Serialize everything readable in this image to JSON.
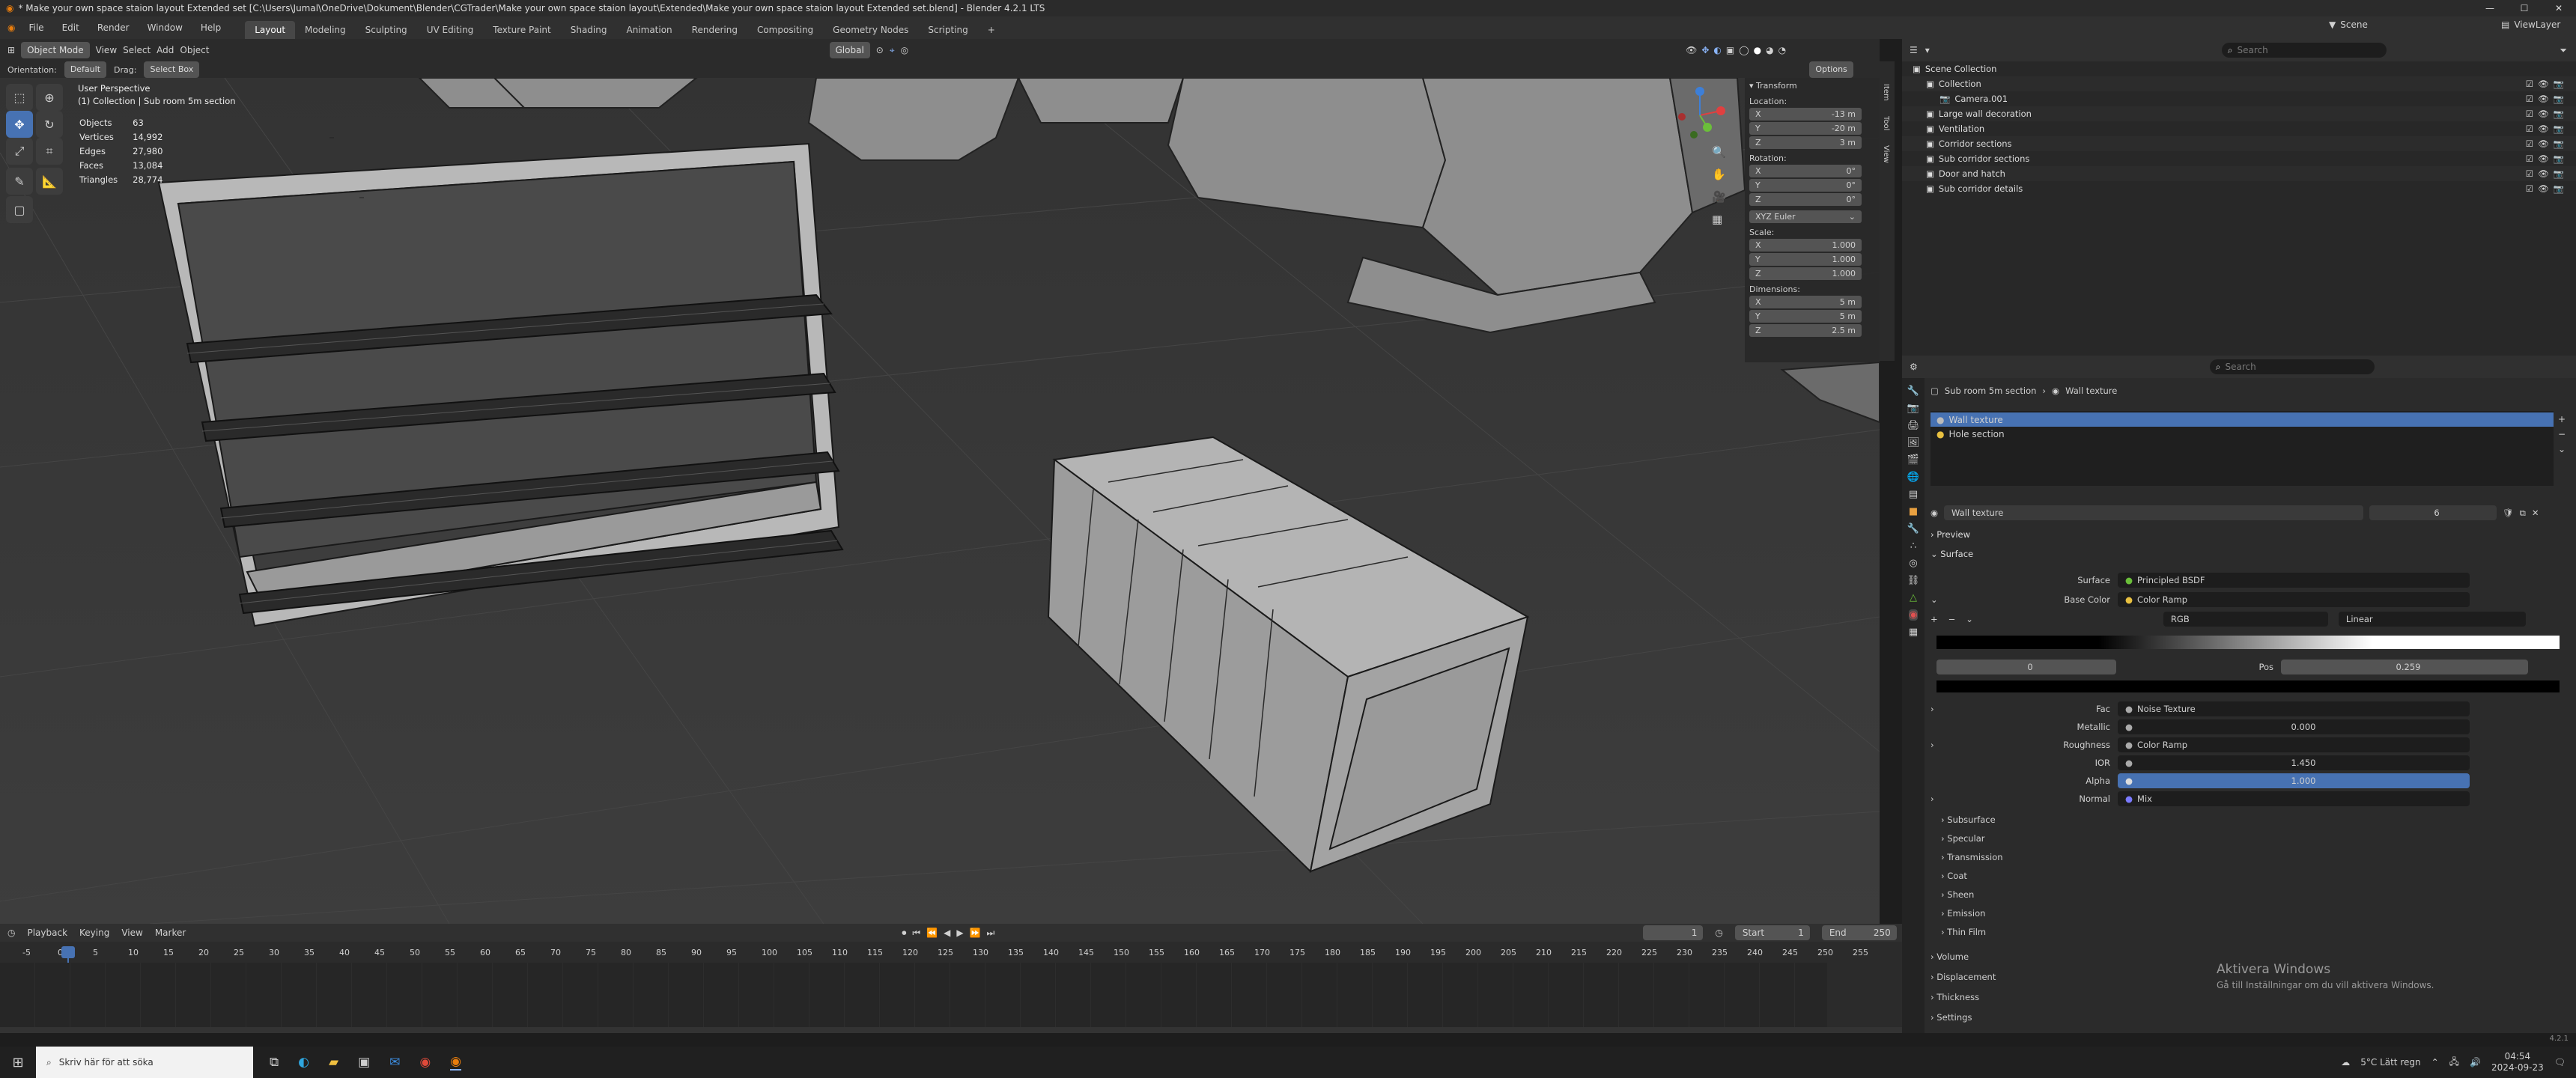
{
  "titlebar": {
    "title": "* Make your own space staion layout Extended set [C:\\Users\\Jumal\\OneDrive\\Dokument\\Blender\\CGTrader\\Make your own space staion layout\\Extended\\Make your own space staion layout Extended set.blend] - Blender 4.2.1 LTS"
  },
  "menu": [
    "File",
    "Edit",
    "Render",
    "Window",
    "Help"
  ],
  "workspaces": [
    "Layout",
    "Modeling",
    "Sculpting",
    "UV Editing",
    "Texture Paint",
    "Shading",
    "Animation",
    "Rendering",
    "Compositing",
    "Geometry Nodes",
    "Scripting"
  ],
  "scene": {
    "label": "Scene",
    "viewlayer": "ViewLayer"
  },
  "header": {
    "mode": "Object Mode",
    "view": "View",
    "select": "Select",
    "add": "Add",
    "object": "Object",
    "orientation": "Global"
  },
  "subheader": {
    "orientation_label": "Orientation:",
    "orientation_value": "Default",
    "drag_label": "Drag:",
    "drag_value": "Select Box",
    "options": "Options"
  },
  "viewport": {
    "persp": "User Perspective",
    "context": "(1) Collection | Sub room 5m section",
    "stats": [
      {
        "k": "Objects",
        "v": "63"
      },
      {
        "k": "Vertices",
        "v": "14,992"
      },
      {
        "k": "Edges",
        "v": "27,980"
      },
      {
        "k": "Faces",
        "v": "13,084"
      },
      {
        "k": "Triangles",
        "v": "28,774"
      }
    ]
  },
  "transform": {
    "title": "Transform",
    "location_label": "Location:",
    "location": [
      {
        "a": "X",
        "v": "-13 m"
      },
      {
        "a": "Y",
        "v": "-20 m"
      },
      {
        "a": "Z",
        "v": "3 m"
      }
    ],
    "rotation_label": "Rotation:",
    "rotation": [
      {
        "a": "X",
        "v": "0°"
      },
      {
        "a": "Y",
        "v": "0°"
      },
      {
        "a": "Z",
        "v": "0°"
      }
    ],
    "euler": "XYZ Euler",
    "scale_label": "Scale:",
    "scale": [
      {
        "a": "X",
        "v": "1.000"
      },
      {
        "a": "Y",
        "v": "1.000"
      },
      {
        "a": "Z",
        "v": "1.000"
      }
    ],
    "dims_label": "Dimensions:",
    "dims": [
      {
        "a": "X",
        "v": "5 m"
      },
      {
        "a": "Y",
        "v": "5 m"
      },
      {
        "a": "Z",
        "v": "2.5 m"
      }
    ]
  },
  "ntabs": [
    "Item",
    "Tool",
    "View"
  ],
  "outliner": {
    "search": "Search",
    "items": [
      {
        "name": "Scene Collection",
        "indent": 0
      },
      {
        "name": "Collection",
        "indent": 1
      },
      {
        "name": "Camera.001",
        "indent": 2
      },
      {
        "name": "Large wall decoration",
        "indent": 1
      },
      {
        "name": "Ventilation",
        "indent": 1
      },
      {
        "name": "Corridor sections",
        "indent": 1
      },
      {
        "name": "Sub corridor sections",
        "indent": 1
      },
      {
        "name": "Door and hatch",
        "indent": 1
      },
      {
        "name": "Sub corridor details",
        "indent": 1
      }
    ]
  },
  "properties": {
    "search": "Search",
    "breadcrumb_obj": "Sub room 5m section",
    "breadcrumb_mat": "Wall texture",
    "slots": [
      "Wall texture",
      "Hole section"
    ],
    "material_name": "Wall texture",
    "users": "6",
    "preview": "Preview",
    "surface_section": "Surface",
    "surface_label": "Surface",
    "surface_value": "Principled BSDF",
    "basecolor_label": "Base Color",
    "basecolor_value": "Color Ramp",
    "ramp_mode": "RGB",
    "ramp_interp": "Linear",
    "ramp_index": "0",
    "pos_label": "Pos",
    "pos_value": "0.259",
    "fac_label": "Fac",
    "fac_value": "Noise Texture",
    "metallic_label": "Metallic",
    "metallic_value": "0.000",
    "roughness_label": "Roughness",
    "roughness_value": "Color Ramp",
    "ior_label": "IOR",
    "ior_value": "1.450",
    "alpha_label": "Alpha",
    "alpha_value": "1.000",
    "normal_label": "Normal",
    "normal_value": "Mix",
    "subsections": [
      "Subsurface",
      "Specular",
      "Transmission",
      "Coat",
      "Sheen",
      "Emission",
      "Thin Film"
    ],
    "sections": [
      "Volume",
      "Displacement",
      "Thickness",
      "Settings"
    ]
  },
  "timeline": {
    "playback": "Playback",
    "keying": "Keying",
    "view": "View",
    "marker": "Marker",
    "current": "1",
    "start_label": "Start",
    "start": "1",
    "end_label": "End",
    "end": "250",
    "ticks": [
      "-5",
      "0",
      "5",
      "10",
      "15",
      "20",
      "25",
      "30",
      "35",
      "40",
      "45",
      "50",
      "55",
      "60",
      "65",
      "70",
      "75",
      "80",
      "85",
      "90",
      "95",
      "100",
      "105",
      "110",
      "115",
      "120",
      "125",
      "130",
      "135",
      "140",
      "145",
      "150",
      "155",
      "160",
      "165",
      "170",
      "175",
      "180",
      "185",
      "190",
      "195",
      "200",
      "205",
      "210",
      "215",
      "220",
      "225",
      "230",
      "235",
      "240",
      "245",
      "250",
      "255"
    ]
  },
  "watermark": {
    "title": "Aktivera Windows",
    "sub": "Gå till Inställningar om du vill aktivera Windows."
  },
  "version": "4.2.1",
  "taskbar": {
    "search": "Skriv här för att söka",
    "weather": "5°C  Lätt regn",
    "time": "04:54",
    "date": "2024-09-23"
  },
  "colors": {
    "accent": "#4772b3",
    "alpha_bar": "#4772b3",
    "slot_selected": "#4772b3"
  }
}
